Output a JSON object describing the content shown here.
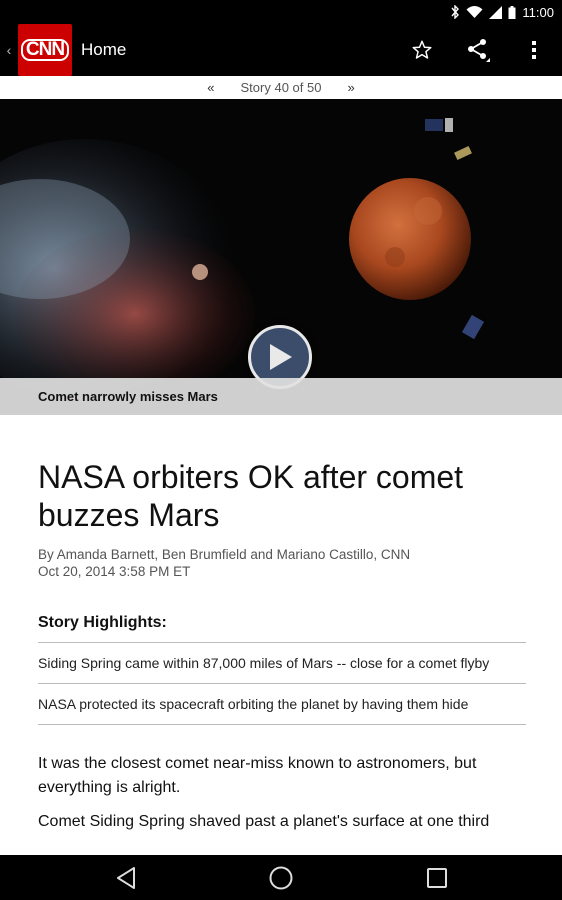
{
  "status_bar": {
    "time": "11:00"
  },
  "app_bar": {
    "title": "Home",
    "logo_text": "CNN"
  },
  "pager": {
    "prev": "«",
    "label": "Story 40 of 50",
    "next": "»"
  },
  "video": {
    "caption": "Comet narrowly misses Mars"
  },
  "article": {
    "headline": "NASA orbiters OK after comet buzzes Mars",
    "byline": "By Amanda Barnett, Ben Brumfield and Mariano Castillo, CNN",
    "date": "Oct 20, 2014 3:58 PM ET",
    "highlights_title": "Story Highlights:",
    "highlights": [
      "Siding Spring came within 87,000 miles of Mars -- close for a comet flyby",
      "NASA protected its spacecraft orbiting the planet by having them hide"
    ],
    "paragraphs": [
      "It was the closest comet near-miss known to astronomers, but everything is alright.",
      "Comet Siding Spring shaved past a planet's surface at one third"
    ]
  },
  "icons": [
    "bluetooth-icon",
    "wifi-icon",
    "signal-icon",
    "battery-icon",
    "up-icon",
    "star-icon",
    "share-icon",
    "overflow-menu-icon",
    "play-icon",
    "back-icon",
    "home-icon",
    "recents-icon"
  ]
}
